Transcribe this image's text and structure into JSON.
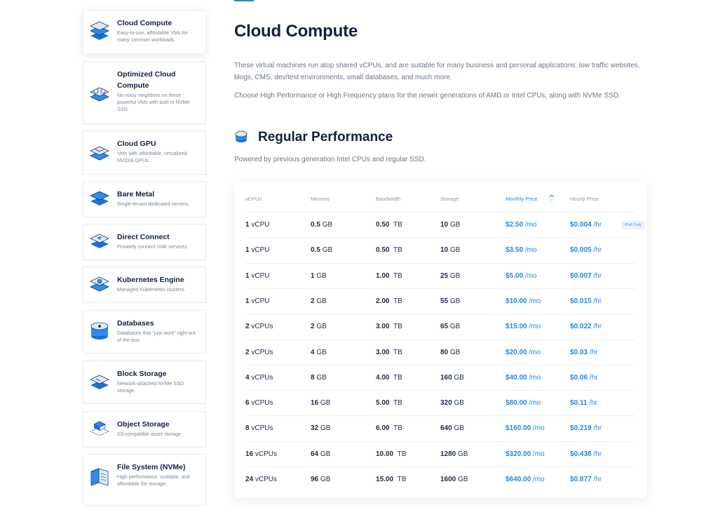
{
  "sidebar": {
    "items": [
      {
        "title": "Cloud Compute",
        "desc": "Easy-to-use, affordable VMs for many common workloads.",
        "icon": "cloud-compute-icon"
      },
      {
        "title": "Optimized Cloud Compute",
        "desc": "No noisy neighbors on these powerful VMs with built-in NVMe SSD.",
        "icon": "optimized-compute-icon"
      },
      {
        "title": "Cloud GPU",
        "desc": "VMs with affordable, virtualized NVIDIA GPUs.",
        "icon": "gpu-icon"
      },
      {
        "title": "Bare Metal",
        "desc": "Single-tenant dedicated servers.",
        "icon": "bare-metal-icon"
      },
      {
        "title": "Direct Connect",
        "desc": "Privately connect Vultr services.",
        "icon": "direct-connect-icon"
      },
      {
        "title": "Kubernetes Engine",
        "desc": "Managed Kubernetes clusters.",
        "icon": "kubernetes-icon"
      },
      {
        "title": "Databases",
        "desc": "Databases that \"just work\" right out of the box.",
        "icon": "database-icon"
      },
      {
        "title": "Block Storage",
        "desc": "Network-attached NVMe SSD storage.",
        "icon": "block-storage-icon"
      },
      {
        "title": "Object Storage",
        "desc": "S3-compatible asset storage.",
        "icon": "object-storage-icon"
      },
      {
        "title": "File System (NVMe)",
        "desc": "High performance, scalable, and affordable file storage.",
        "icon": "file-system-icon"
      }
    ]
  },
  "main": {
    "title": "Cloud Compute",
    "intro1": "These virtual machines run atop shared vCPUs, and are suitable for many business and personal applications: low traffic websites, blogs, CMS, dev/test environments, small databases, and much more.",
    "intro2": "Choose High Performance or High Frequency plans for the newer generations of AMD or Intel CPUs, along with NVMe SSD.",
    "section_title": "Regular Performance",
    "section_desc": "Powered by previous generation Intel CPUs and regular SSD."
  },
  "colors": {
    "accent": "#1e88e5",
    "heading": "#13203f",
    "muted": "#6c7589"
  },
  "table": {
    "headers": {
      "vcpus": "vCPUs",
      "memory": "Memory",
      "bandwidth": "Bandwidth",
      "storage": "Storage",
      "monthly": "Monthly Price",
      "hourly": "Hourly Price"
    },
    "rows": [
      {
        "cpu": "1",
        "cpu_unit": "vCPU",
        "mem": "0.5",
        "mem_unit": "GB",
        "bw": "0.50",
        "bw_unit": "TB",
        "st": "10",
        "st_unit": "GB",
        "mo": "$2.50",
        "mo_unit": "/mo",
        "hr": "$0.004",
        "hr_unit": "/hr",
        "badge": "IPv6 Only"
      },
      {
        "cpu": "1",
        "cpu_unit": "vCPU",
        "mem": "0.5",
        "mem_unit": "GB",
        "bw": "0.50",
        "bw_unit": "TB",
        "st": "10",
        "st_unit": "GB",
        "mo": "$3.50",
        "mo_unit": "/mo",
        "hr": "$0.005",
        "hr_unit": "/hr"
      },
      {
        "cpu": "1",
        "cpu_unit": "vCPU",
        "mem": "1",
        "mem_unit": "GB",
        "bw": "1.00",
        "bw_unit": "TB",
        "st": "25",
        "st_unit": "GB",
        "mo": "$5.00",
        "mo_unit": "/mo",
        "hr": "$0.007",
        "hr_unit": "/hr"
      },
      {
        "cpu": "1",
        "cpu_unit": "vCPU",
        "mem": "2",
        "mem_unit": "GB",
        "bw": "2.00",
        "bw_unit": "TB",
        "st": "55",
        "st_unit": "GB",
        "mo": "$10.00",
        "mo_unit": "/mo",
        "hr": "$0.015",
        "hr_unit": "/hr"
      },
      {
        "cpu": "2",
        "cpu_unit": "vCPUs",
        "mem": "2",
        "mem_unit": "GB",
        "bw": "3.00",
        "bw_unit": "TB",
        "st": "65",
        "st_unit": "GB",
        "mo": "$15.00",
        "mo_unit": "/mo",
        "hr": "$0.022",
        "hr_unit": "/hr"
      },
      {
        "cpu": "2",
        "cpu_unit": "vCPUs",
        "mem": "4",
        "mem_unit": "GB",
        "bw": "3.00",
        "bw_unit": "TB",
        "st": "80",
        "st_unit": "GB",
        "mo": "$20.00",
        "mo_unit": "/mo",
        "hr": "$0.03",
        "hr_unit": "/hr"
      },
      {
        "cpu": "4",
        "cpu_unit": "vCPUs",
        "mem": "8",
        "mem_unit": "GB",
        "bw": "4.00",
        "bw_unit": "TB",
        "st": "160",
        "st_unit": "GB",
        "mo": "$40.00",
        "mo_unit": "/mo",
        "hr": "$0.06",
        "hr_unit": "/hr"
      },
      {
        "cpu": "6",
        "cpu_unit": "vCPUs",
        "mem": "16",
        "mem_unit": "GB",
        "bw": "5.00",
        "bw_unit": "TB",
        "st": "320",
        "st_unit": "GB",
        "mo": "$80.00",
        "mo_unit": "/mo",
        "hr": "$0.11",
        "hr_unit": "/hr"
      },
      {
        "cpu": "8",
        "cpu_unit": "vCPUs",
        "mem": "32",
        "mem_unit": "GB",
        "bw": "6.00",
        "bw_unit": "TB",
        "st": "640",
        "st_unit": "GB",
        "mo": "$160.00",
        "mo_unit": "/mo",
        "hr": "$0.219",
        "hr_unit": "/hr"
      },
      {
        "cpu": "16",
        "cpu_unit": "vCPUs",
        "mem": "64",
        "mem_unit": "GB",
        "bw": "10.00",
        "bw_unit": "TB",
        "st": "1280",
        "st_unit": "GB",
        "mo": "$320.00",
        "mo_unit": "/mo",
        "hr": "$0.438",
        "hr_unit": "/hr"
      },
      {
        "cpu": "24",
        "cpu_unit": "vCPUs",
        "mem": "96",
        "mem_unit": "GB",
        "bw": "15.00",
        "bw_unit": "TB",
        "st": "1600",
        "st_unit": "GB",
        "mo": "$640.00",
        "mo_unit": "/mo",
        "hr": "$0.877",
        "hr_unit": "/hr"
      }
    ]
  }
}
